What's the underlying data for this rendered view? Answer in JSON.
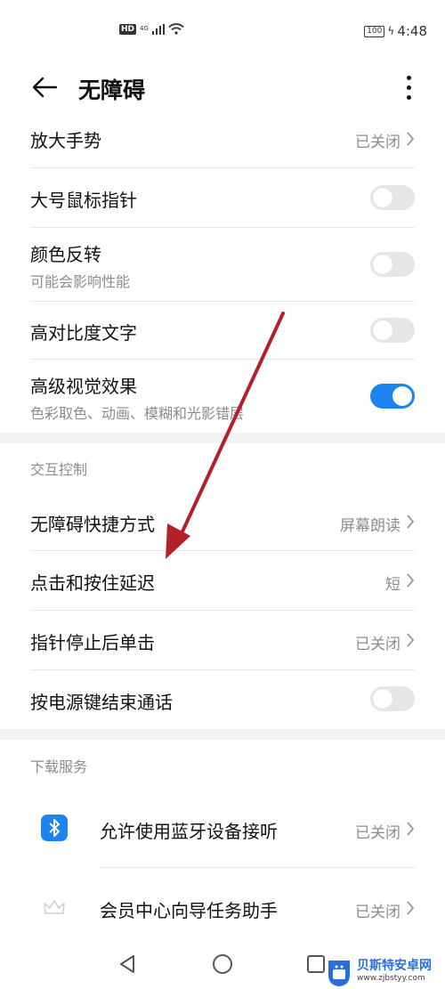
{
  "status_bar": {
    "hd": "HD",
    "network": "4G",
    "battery": "100",
    "time": "4:48"
  },
  "header": {
    "title": "无障碍",
    "back_icon": "arrow-left-icon",
    "more_icon": "more-vertical-icon"
  },
  "items": {
    "magnify": {
      "label": "放大手势",
      "value": "已关闭"
    },
    "large_pointer": {
      "label": "大号鼠标指针",
      "toggle": false
    },
    "color_inversion": {
      "label": "颜色反转",
      "subtitle": "可能会影响性能",
      "toggle": false
    },
    "high_contrast": {
      "label": "高对比度文字",
      "toggle": false
    },
    "advanced_visual": {
      "label": "高级视觉效果",
      "subtitle": "色彩取色、动画、模糊和光影错层",
      "toggle": true
    }
  },
  "interaction": {
    "section_label": "交互控制",
    "shortcut": {
      "label": "无障碍快捷方式",
      "value": "屏幕朗读"
    },
    "touch_hold_delay": {
      "label": "点击和按住延迟",
      "value": "短"
    },
    "dwell_click": {
      "label": "指针停止后单击",
      "value": "已关闭"
    },
    "power_end_call": {
      "label": "按电源键结束通话",
      "toggle": false
    }
  },
  "download": {
    "section_label": "下载服务",
    "bluetooth": {
      "label": "允许使用蓝牙设备接听",
      "value": "已关闭",
      "icon": "bluetooth-icon"
    },
    "member": {
      "label": "会员中心向导任务助手",
      "value": "已关闭",
      "icon": "crown-icon"
    }
  },
  "nav": {
    "back_icon": "nav-back-icon",
    "home_icon": "nav-home-icon",
    "recents_icon": "nav-recents-icon"
  },
  "watermark": {
    "title": "贝斯特安卓网",
    "url": "www.zjbstyy.com"
  },
  "colors": {
    "accent": "#1c83f0",
    "arrow": "#b3202a"
  }
}
